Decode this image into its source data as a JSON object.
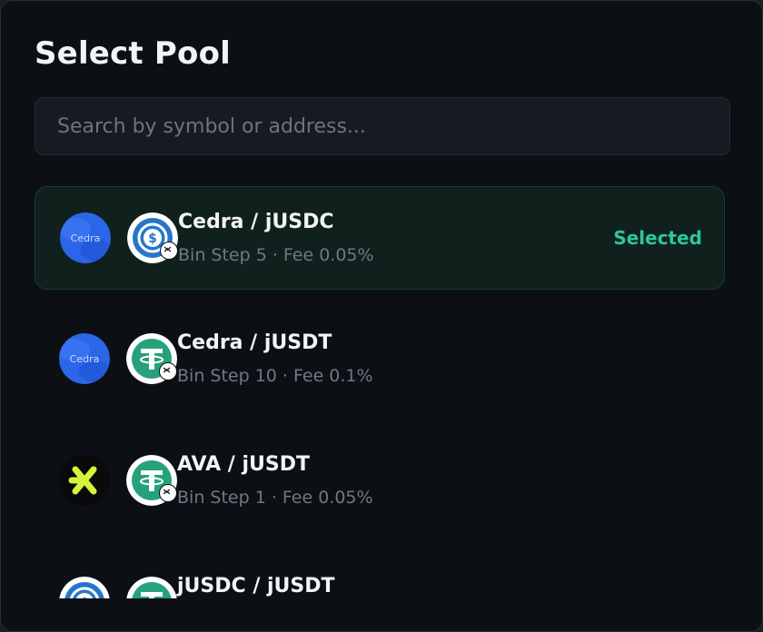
{
  "modal": {
    "title": "Select Pool"
  },
  "search": {
    "placeholder": "Search by symbol or address..."
  },
  "pools": [
    {
      "pair": "Cedra / jUSDC",
      "meta": "Bin Step 5 · Fee 0.05%",
      "status": "Selected",
      "token_a_icon": "cedra-logo-icon",
      "token_b_icon": "usdc-logo-icon"
    },
    {
      "pair": "Cedra / jUSDT",
      "meta": "Bin Step 10 · Fee 0.1%",
      "token_a_icon": "cedra-logo-icon",
      "token_b_icon": "tether-logo-icon"
    },
    {
      "pair": "AVA / jUSDT",
      "meta": "Bin Step 1 · Fee 0.05%",
      "token_a_icon": "ava-logo-icon",
      "token_b_icon": "tether-logo-icon"
    },
    {
      "pair": "jUSDC / jUSDT",
      "token_a_icon": "usdc-logo-icon",
      "token_b_icon": "tether-logo-icon"
    }
  ],
  "token_logos": {
    "cedra": "Cedra"
  },
  "colors": {
    "accent": "#2ec79a",
    "cedra": "#2c66e8",
    "usdc": "#2775ca",
    "tether": "#26a17b",
    "ava": "#d4f53c"
  }
}
